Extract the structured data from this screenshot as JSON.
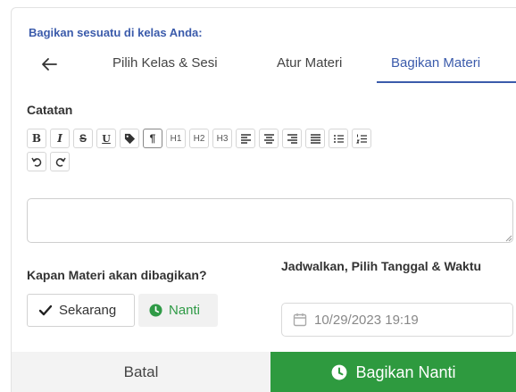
{
  "header": {
    "title": "Bagikan sesuatu di kelas Anda:",
    "tabs": [
      {
        "label": "Pilih Kelas & Sesi"
      },
      {
        "label": "Atur Materi"
      },
      {
        "label": "Bagikan Materi"
      }
    ],
    "active_tab": 2
  },
  "notes": {
    "label": "Catatan",
    "toolbar": [
      {
        "label": "B"
      },
      {
        "label": "I"
      },
      {
        "label": "S"
      },
      {
        "label": "U"
      },
      {
        "label": "tag"
      },
      {
        "label": "¶"
      },
      {
        "label": "H1"
      },
      {
        "label": "H2"
      },
      {
        "label": "H3"
      }
    ],
    "editor_value": ""
  },
  "share_time": {
    "label": "Kapan Materi akan dibagikan?",
    "option_now": "Sekarang",
    "option_later": "Nanti",
    "selected": "later"
  },
  "schedule": {
    "label": "Jadwalkan, Pilih Tanggal & Waktu",
    "datetime_value": "10/29/2023 19:19"
  },
  "footer": {
    "cancel_label": "Batal",
    "share_label": "Bagikan Nanti"
  },
  "colors": {
    "accent_blue": "#3b5bab",
    "accent_green": "#2e9a3f"
  }
}
